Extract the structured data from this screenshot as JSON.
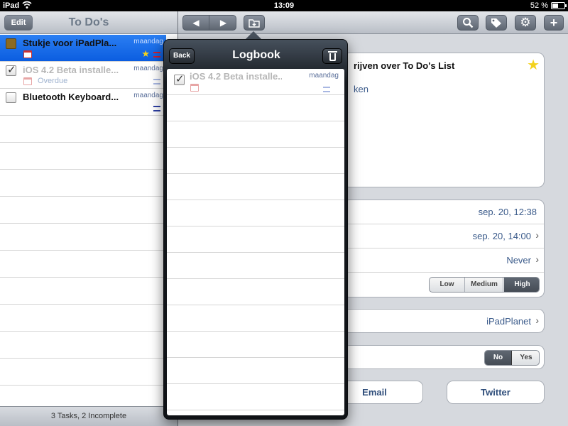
{
  "status_bar": {
    "device": "iPad",
    "time": "13:09",
    "battery_text": "52 %",
    "battery_level": 0.52
  },
  "todos": {
    "edit_label": "Edit",
    "title": "To Do's",
    "footer": "3 Tasks, 2 Incomplete",
    "tasks": [
      {
        "title": "Stukje voor iPadPla...",
        "date": "maandag",
        "subtitle": "",
        "checked": false,
        "selected": true,
        "starred": true,
        "priority": "red"
      },
      {
        "title": "iOS 4.2 Beta installe...",
        "date": "maandag",
        "subtitle": "Overdue",
        "checked": true,
        "selected": false,
        "starred": false,
        "priority": "light"
      },
      {
        "title": "Bluetooth Keyboard...",
        "date": "maandag",
        "subtitle": "",
        "checked": false,
        "selected": false,
        "starred": false,
        "priority": "blue"
      }
    ]
  },
  "toolbar": {
    "prev_icon": "arrow-left-icon",
    "next_icon": "arrow-right-icon",
    "logbook_icon": "logbook-icon",
    "search_icon": "search-icon",
    "tag_icon": "tag-icon",
    "gear_icon": "gear-icon",
    "add_icon": "plus-icon",
    "add_label": "+"
  },
  "detail": {
    "title_visible": "rijven over To Do's List",
    "note_visible": "ken",
    "starred": true,
    "created": "sep. 20, 12:38",
    "due": "sep. 20, 14:00",
    "repeat": "Never",
    "priority_options": [
      "Low",
      "Medium",
      "High"
    ],
    "priority_selected": "High",
    "project": "iPadPlanet",
    "yesno_options": [
      "No",
      "Yes"
    ],
    "yesno_selected": "No",
    "share_email": "Email",
    "share_twitter": "Twitter",
    "colors": {
      "accent": "#0b5de0",
      "link_text": "#3a5a8a",
      "star": "#f3d21d"
    }
  },
  "logbook": {
    "back_label": "Back",
    "title": "Logbook",
    "item": {
      "title": "iOS 4.2 Beta installe...",
      "date": "maandag",
      "checked": true
    }
  }
}
